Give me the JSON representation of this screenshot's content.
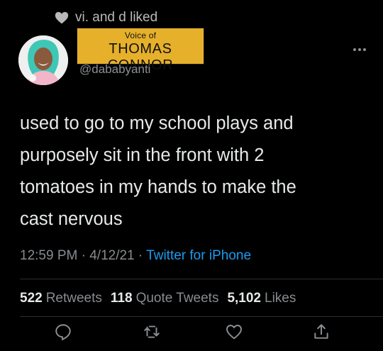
{
  "social_context": {
    "text": "vi. and d liked"
  },
  "sticker": {
    "line1": "Voice of",
    "line2": "THOMAS CONNOR"
  },
  "author": {
    "handle": "@dababyanti"
  },
  "tweet": {
    "lines": [
      "used to go to my school plays and",
      "purposely sit in the front with 2",
      "tomatoes in my hands to make the",
      "cast nervous"
    ],
    "time": "12:59 PM",
    "sep1": "·",
    "date": "4/12/21",
    "sep2": "·",
    "source": "Twitter for iPhone"
  },
  "stats": {
    "retweets_count": "522",
    "retweets_label": "Retweets",
    "quotes_count": "118",
    "quotes_label": "Quote Tweets",
    "likes_count": "5,102",
    "likes_label": "Likes"
  },
  "actions": {
    "icons": [
      "reply-icon",
      "retweet-icon",
      "like-icon",
      "share-icon"
    ]
  },
  "colors": {
    "background": "#000000",
    "link": "#1d9bf0",
    "sticker": "#e6b02b",
    "muted": "#878c90"
  }
}
